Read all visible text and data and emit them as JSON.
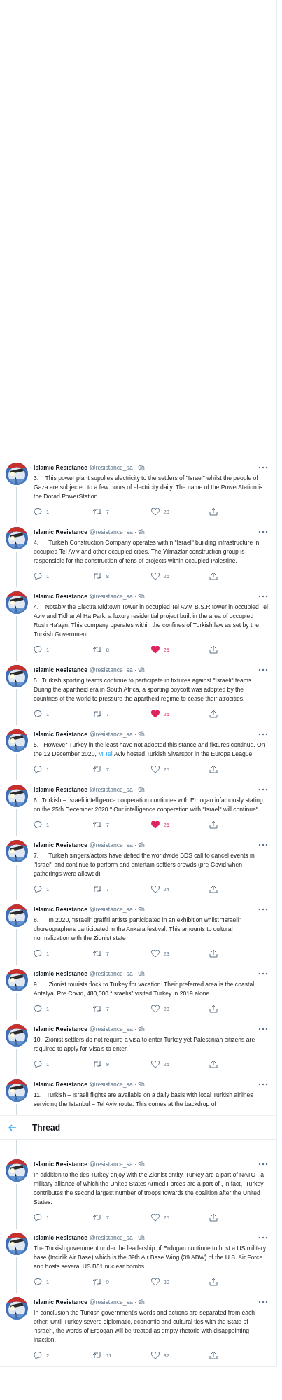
{
  "thread_above": [
    {
      "author": "Islamic Resistance",
      "meta": "@resistance_sa · 9h",
      "body": [
        {
          "kind": "text",
          "text": "3.    This power plant supplies electricity to the settlers of \"Israel\" whilst the people of Gaza are subjected to a few hours of electricity daily. The name of the PowerStation is the Dorad PowerStation."
        }
      ],
      "stats": {
        "replies": "1",
        "retweets": "7",
        "likes": "28",
        "liked": false
      }
    },
    {
      "author": "Islamic Resistance",
      "meta": "@resistance_sa · 9h",
      "body": [
        {
          "kind": "text",
          "text": "4.      Turkish Construction Company operates within \"Israel\" building infrastructure in occupied Tel Aviv and other occupied cities. The Yilmazlar construction group is responsible for the construction of tens of projects within occupied Palestine."
        }
      ],
      "stats": {
        "replies": "1",
        "retweets": "8",
        "likes": "26",
        "liked": false
      }
    },
    {
      "author": "Islamic Resistance",
      "meta": "@resistance_sa · 9h",
      "body": [
        {
          "kind": "text",
          "text": "4.    Notably the Electra Midtown Tower in occupied Tel Aviv, B.S.R tower in occupied Tel Aviv and Tidhar Al Ha Park, a luxury residential project built in the area of occupied Rosh Ha'ayn. This company operates within the confines of Turkish law as set by the Turkish Government."
        }
      ],
      "stats": {
        "replies": "1",
        "retweets": "8",
        "likes": "25",
        "liked": true
      }
    },
    {
      "author": "Islamic Resistance",
      "meta": "@resistance_sa · 9h",
      "body": [
        {
          "kind": "text",
          "text": "5.  Turkish sporting teams continue to participate in fixtures against \"Israeli\" teams. During the apartheid era in South Africa, a sporting boycott was adopted by the countries of the world to pressure the apartheid regime to cease their atrocities."
        }
      ],
      "stats": {
        "replies": "1",
        "retweets": "7",
        "likes": "25",
        "liked": true
      }
    },
    {
      "author": "Islamic Resistance",
      "meta": "@resistance_sa · 9h",
      "body": [
        {
          "kind": "text",
          "text": "5.   However Turkey in the least have not adopted this stance and fixtures continue. On the 12 December 2020, "
        },
        {
          "kind": "link",
          "text": "M.Tel"
        },
        {
          "kind": "text",
          "text": " Aviv hosted Turkish Sivarspor in the Europa League."
        }
      ],
      "stats": {
        "replies": "1",
        "retweets": "7",
        "likes": "25",
        "liked": false
      }
    },
    {
      "author": "Islamic Resistance",
      "meta": "@resistance_sa · 9h",
      "body": [
        {
          "kind": "text",
          "text": "6.  Turkish – Israeli intelligence cooperation continues with Erdogan infamously stating on the 25th December 2020 \" Our intelligence cooperation with \"Israel\" will continue\""
        }
      ],
      "stats": {
        "replies": "1",
        "retweets": "7",
        "likes": "26",
        "liked": true
      }
    },
    {
      "author": "Islamic Resistance",
      "meta": "@resistance_sa · 9h",
      "body": [
        {
          "kind": "text",
          "text": "7.      Turkish singers/actors have defied the worldwide BDS call to cancel events in \"Israel\" and continue to perform and entertain settlers crowds (pre-Covid when gatherings were allowed)"
        }
      ],
      "stats": {
        "replies": "1",
        "retweets": "7",
        "likes": "24",
        "liked": false
      }
    },
    {
      "author": "Islamic Resistance",
      "meta": "@resistance_sa · 9h",
      "body": [
        {
          "kind": "text",
          "text": "8.      In 2020, “Israeli” graffiti artists participated in an exhibition whilst “Israeli” choreographers participated in the Ankara festival. This amounts to cultural normalization with the Zionist state"
        }
      ],
      "stats": {
        "replies": "1",
        "retweets": "7",
        "likes": "23",
        "liked": false
      }
    },
    {
      "author": "Islamic Resistance",
      "meta": "@resistance_sa · 9h",
      "body": [
        {
          "kind": "text",
          "text": "9.      Zionist tourists flock to Turkey for vacation. Their preferred area is the coastal Antalya. Pre Covid, 480,000 “Israelis” visited Turkey in 2019 alone."
        }
      ],
      "stats": {
        "replies": "1",
        "retweets": "7",
        "likes": "23",
        "liked": false
      }
    },
    {
      "author": "Islamic Resistance",
      "meta": "@resistance_sa · 9h",
      "body": [
        {
          "kind": "text",
          "text": "10.  Zionist settlers do not require a visa to enter Turkey yet Palestinian citizens are required to apply for Visa's to enter."
        }
      ],
      "stats": {
        "replies": "1",
        "retweets": "9",
        "likes": "25",
        "liked": false
      }
    },
    {
      "author": "Islamic Resistance",
      "meta": "@resistance_sa · 9h",
      "body": [
        {
          "kind": "text",
          "text": "11.   Turkish – Israeli flights are available on a daily basis with local Turkish airlines servicing the Istanbul – Tel Aviv route. This comes at the backdrop of"
        }
      ]
    }
  ],
  "header": {
    "title": "Thread"
  },
  "thread_below": [
    {
      "author": "Islamic Resistance",
      "meta": "@resistance_sa · 9h",
      "body": [
        {
          "kind": "text",
          "text": "In addition to the ties Turkey enjoy with the Zionist entity, Turkey are a part of NATO , a military alliance of which the United States Armed Forces are a part of , in fact,  Turkey contributes the second largest number of troops towards the coalition after the United States."
        }
      ],
      "stats": {
        "replies": "1",
        "retweets": "7",
        "likes": "25",
        "liked": false
      }
    },
    {
      "author": "Islamic Resistance",
      "meta": "@resistance_sa · 9h",
      "body": [
        {
          "kind": "text",
          "text": "The Turkish government under the leadership of Erdogan continue to host a US military base (Incirlik Air Base) which is the 39th Air Base Wing (39 ABW) of the U.S. Air Force and hosts several US B61 nuclear bombs."
        }
      ],
      "stats": {
        "replies": "1",
        "retweets": "9",
        "likes": "30",
        "liked": false
      }
    },
    {
      "author": "Islamic Resistance",
      "meta": "@resistance_sa · 9h",
      "body": [
        {
          "kind": "text",
          "text": "In conclusion the Turkish government’s words and actions are separated from each other. Until Turkey severe diplomatic, economic and cultural ties with the State of \"Israel\", the words of Erdogan will be treated as empty rhetoric with disappointing inaction."
        }
      ],
      "stats": {
        "replies": "2",
        "retweets": "11",
        "likes": "32",
        "liked": false
      }
    }
  ]
}
